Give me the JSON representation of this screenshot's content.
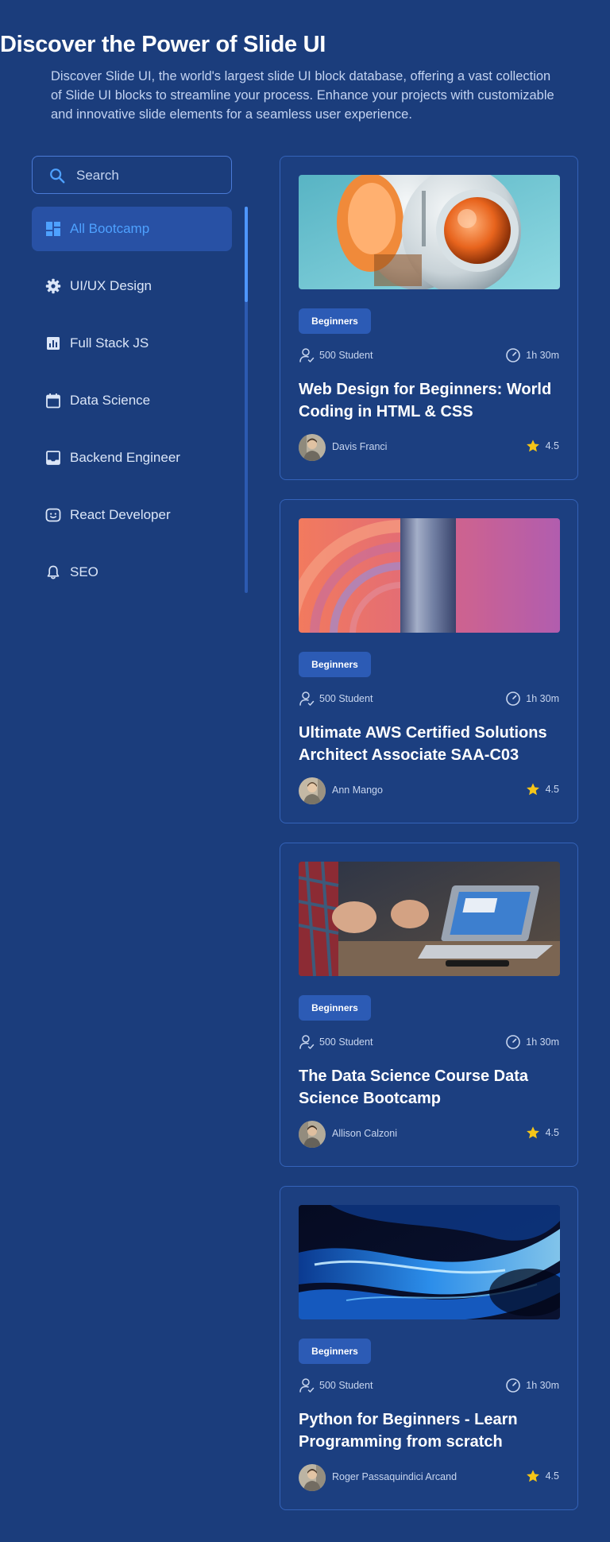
{
  "header": {
    "title": "Discover the Power of Slide UI",
    "subtitle": "Discover Slide UI, the world's largest slide UI block database, offering a vast collection of Slide UI blocks to streamline your process. Enhance your projects with customizable and innovative slide elements for a seamless user experience."
  },
  "search": {
    "placeholder": "Search",
    "value": ""
  },
  "sidebar": {
    "items": [
      {
        "label": "All Bootcamp",
        "icon": "dashboard-icon",
        "active": true
      },
      {
        "label": "UI/UX Design",
        "icon": "gear-icon",
        "active": false
      },
      {
        "label": "Full Stack JS",
        "icon": "bar-chart-icon",
        "active": false
      },
      {
        "label": "Data Science",
        "icon": "calendar-icon",
        "active": false
      },
      {
        "label": "Backend Engineer",
        "icon": "inbox-icon",
        "active": false
      },
      {
        "label": "React Developer",
        "icon": "smiley-icon",
        "active": false
      },
      {
        "label": "SEO",
        "icon": "bell-icon",
        "active": false
      }
    ]
  },
  "courses": [
    {
      "badge": "Beginners",
      "students": "500 Student",
      "duration": "1h 30m",
      "title": "Web Design for Beginners: World Coding in HTML & CSS",
      "author": "Davis Franci",
      "rating": "4.5"
    },
    {
      "badge": "Beginners",
      "students": "500 Student",
      "duration": "1h 30m",
      "title": "Ultimate AWS Certified Solutions Architect Associate SAA-C03",
      "author": "Ann Mango",
      "rating": "4.5"
    },
    {
      "badge": "Beginners",
      "students": "500 Student",
      "duration": "1h 30m",
      "title": "The Data Science Course Data Science Bootcamp",
      "author": "Allison Calzoni",
      "rating": "4.5"
    },
    {
      "badge": "Beginners",
      "students": "500 Student",
      "duration": "1h 30m",
      "title": "Python for Beginners - Learn Programming from scratch",
      "author": "Roger Passaquindici Arcand",
      "rating": "4.5"
    }
  ],
  "colors": {
    "background": "#1b3d7c",
    "accent": "#4ea1ff",
    "active_item_bg": "#2851a5",
    "badge_bg": "#2c5bb5",
    "star": "#f5c518"
  }
}
